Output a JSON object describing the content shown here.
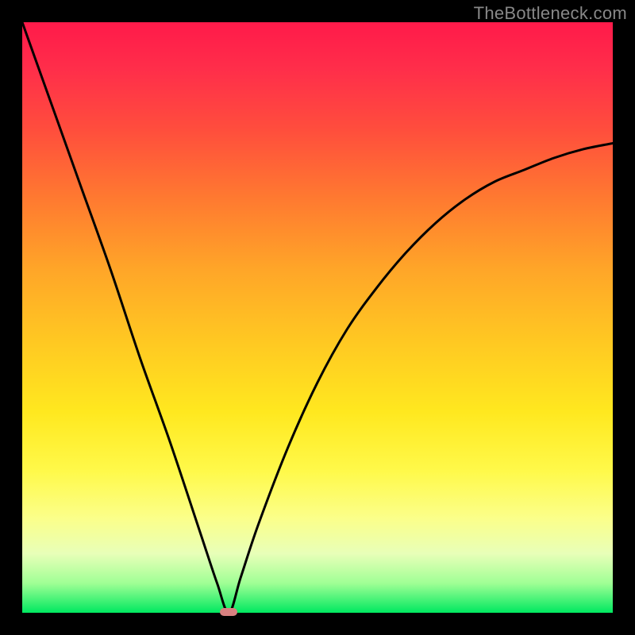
{
  "watermark": "TheBottleneck.com",
  "chart_data": {
    "type": "line",
    "title": "",
    "xlabel": "",
    "ylabel": "",
    "xlim": [
      0,
      100
    ],
    "ylim": [
      0,
      100
    ],
    "note": "V-shaped bottleneck curve over vertical color gradient (red=high bottleneck at top, green=low at bottom). Minimum near x≈35.",
    "series": [
      {
        "name": "bottleneck-curve",
        "x": [
          0,
          5,
          10,
          15,
          20,
          25,
          30,
          33,
          35,
          37,
          40,
          45,
          50,
          55,
          60,
          65,
          70,
          75,
          80,
          85,
          90,
          95,
          100
        ],
        "y": [
          100,
          86,
          72,
          58,
          43,
          29,
          14,
          5,
          0,
          6,
          15,
          28,
          39,
          48,
          55,
          61,
          66,
          70,
          73,
          75,
          77,
          78.5,
          79.5
        ]
      }
    ],
    "marker": {
      "x": 35,
      "y": 0
    },
    "gradient_stops": [
      {
        "pos": 0,
        "color": "#ff1a4a"
      },
      {
        "pos": 50,
        "color": "#ffd422"
      },
      {
        "pos": 100,
        "color": "#00e860"
      }
    ]
  }
}
